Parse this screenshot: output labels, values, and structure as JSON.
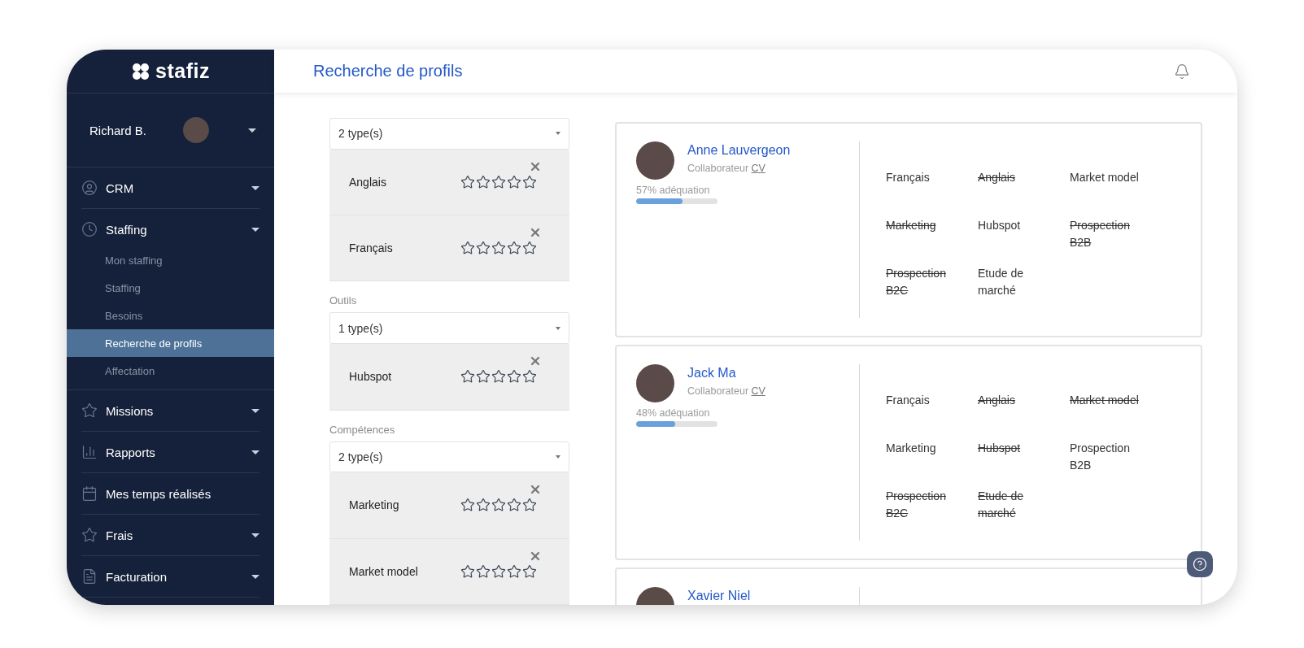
{
  "brand": {
    "name": "stafiz"
  },
  "user": {
    "name": "Richard B."
  },
  "sidebar": {
    "items": [
      {
        "label": "CRM",
        "kind": "menu"
      },
      {
        "label": "Staffing",
        "kind": "menu",
        "children": [
          {
            "label": "Mon staffing",
            "selected": false
          },
          {
            "label": "Staffing",
            "selected": false
          },
          {
            "label": "Besoins",
            "selected": false
          },
          {
            "label": "Recherche de profils",
            "selected": true
          },
          {
            "label": "Affectation",
            "selected": false
          }
        ]
      },
      {
        "label": "Missions",
        "kind": "menu"
      },
      {
        "label": "Rapports",
        "kind": "menu"
      },
      {
        "label": "Mes temps réalisés",
        "kind": "link"
      },
      {
        "label": "Frais",
        "kind": "menu"
      },
      {
        "label": "Facturation",
        "kind": "menu"
      }
    ]
  },
  "header": {
    "title": "Recherche de profils"
  },
  "filters": [
    {
      "select": "2 type(s)",
      "items": [
        {
          "name": "Anglais",
          "stars": 0
        },
        {
          "name": "Français",
          "stars": 0
        }
      ]
    },
    {
      "label": "Outils",
      "select": "1 type(s)",
      "items": [
        {
          "name": "Hubspot",
          "stars": 0
        }
      ]
    },
    {
      "label": "Compétences",
      "select": "2 type(s)",
      "items": [
        {
          "name": "Marketing",
          "stars": 0
        },
        {
          "name": "Market model",
          "stars": 0
        }
      ]
    }
  ],
  "profiles": [
    {
      "name": "Anne Lauvergeon",
      "role": "Collaborateur",
      "cv": "CV",
      "match": "57% adéquation",
      "level": 0.57,
      "skills": [
        {
          "name": "Français",
          "struck": false
        },
        {
          "name": "Anglais",
          "struck": true
        },
        {
          "name": "Market model",
          "struck": false
        },
        {
          "name": "Marketing",
          "struck": true
        },
        {
          "name": "Hubspot",
          "struck": false
        },
        {
          "name": "Prospection B2B",
          "struck": true
        },
        {
          "name": "Prospection B2C",
          "struck": true
        },
        {
          "name": "Etude de marché",
          "struck": false
        }
      ]
    },
    {
      "name": "Jack Ma",
      "role": "Collaborateur",
      "cv": "CV",
      "match": "48% adéquation",
      "level": 0.48,
      "skills": [
        {
          "name": "Français",
          "struck": false
        },
        {
          "name": "Anglais",
          "struck": true
        },
        {
          "name": "Market model",
          "struck": true
        },
        {
          "name": "Marketing",
          "struck": false
        },
        {
          "name": "Hubspot",
          "struck": true
        },
        {
          "name": "Prospection B2B",
          "struck": false
        },
        {
          "name": "Prospection B2C",
          "struck": true
        },
        {
          "name": "Etude de marché",
          "struck": true
        }
      ]
    },
    {
      "name": "Xavier Niel"
    }
  ]
}
